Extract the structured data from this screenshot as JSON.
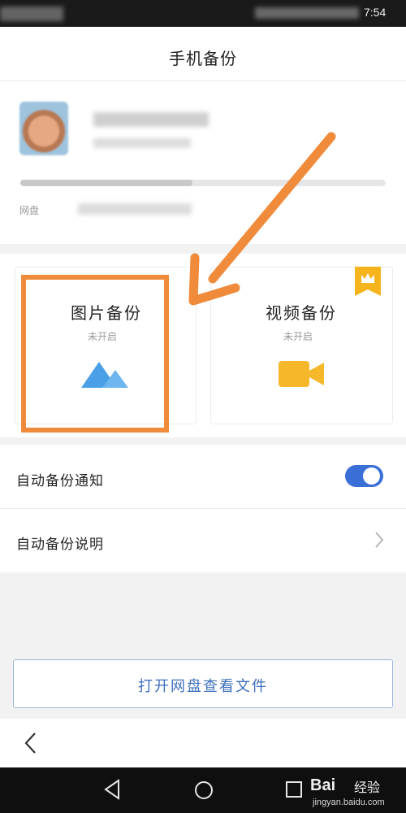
{
  "status_bar": {
    "time": "7:54"
  },
  "header": {
    "title": "手机备份"
  },
  "account": {
    "quota_label": "网盘",
    "quota_fraction": 0.47
  },
  "backup_cards": [
    {
      "title": "图片备份",
      "status": "未开启",
      "icon": "mountain-photo-icon"
    },
    {
      "title": "视频备份",
      "status": "未开启",
      "icon": "video-camera-icon",
      "badge": "vip-crown-icon"
    }
  ],
  "settings": {
    "notify": {
      "label": "自动备份通知",
      "enabled": true
    },
    "info": {
      "label": "自动备份说明"
    }
  },
  "open_button": {
    "label": "打开网盘查看文件"
  },
  "watermark": {
    "brand": "Bai",
    "sub": "经验",
    "url": "jingyan.baidu.com"
  },
  "colors": {
    "accent": "#3a6fd8",
    "highlight": "#ef8b3a",
    "photo_icon": "#4a9fe6",
    "video_icon": "#f5b82a",
    "badge": "#f5b41c"
  }
}
